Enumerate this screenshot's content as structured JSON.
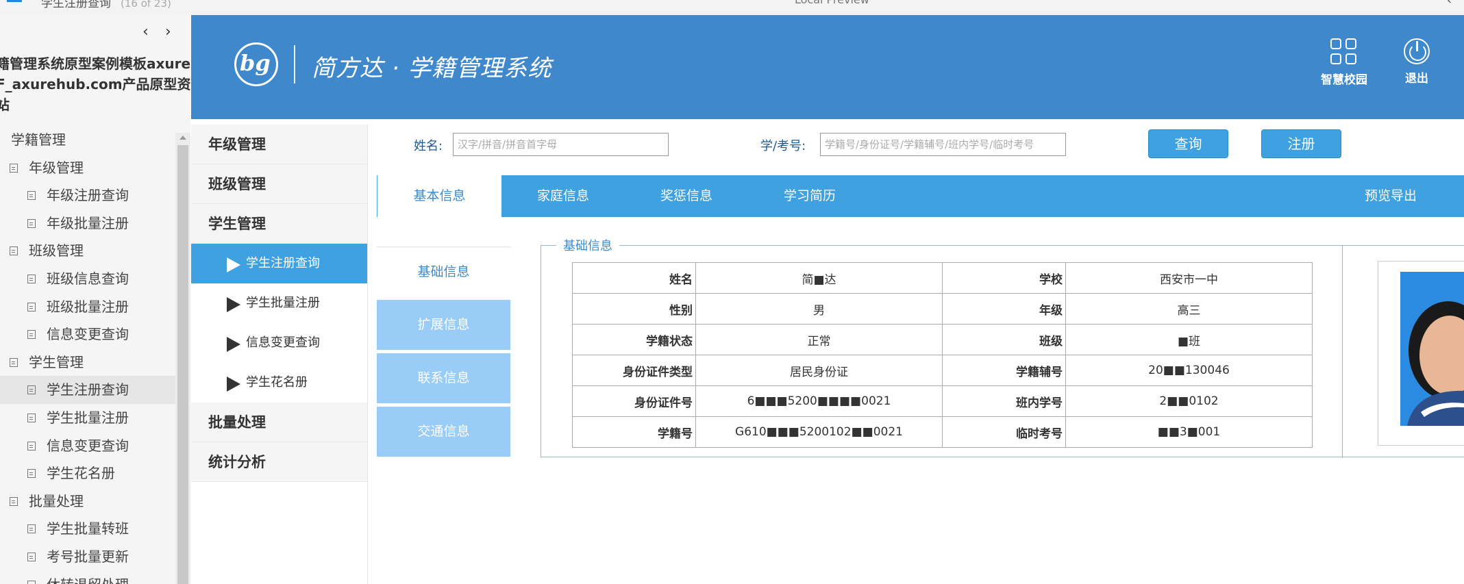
{
  "chrome": {
    "page_title": "学生注册查询",
    "page_count": "(16 of 23)",
    "center_title": "Local Preview"
  },
  "axure_sidebar": {
    "project_title_lines": [
      "籍管理系统原型案例模板axure",
      "F_axurehub.com产品原型资",
      "站"
    ],
    "tree": [
      {
        "label": "学籍管理",
        "level": 0,
        "selected": false
      },
      {
        "label": "年级管理",
        "level": 1,
        "selected": false
      },
      {
        "label": "年级注册查询",
        "level": 2,
        "selected": false
      },
      {
        "label": "年级批量注册",
        "level": 2,
        "selected": false
      },
      {
        "label": "班级管理",
        "level": 1,
        "selected": false
      },
      {
        "label": "班级信息查询",
        "level": 2,
        "selected": false
      },
      {
        "label": "班级批量注册",
        "level": 2,
        "selected": false
      },
      {
        "label": "信息变更查询",
        "level": 2,
        "selected": false
      },
      {
        "label": "学生管理",
        "level": 1,
        "selected": false
      },
      {
        "label": "学生注册查询",
        "level": 2,
        "selected": true
      },
      {
        "label": "学生批量注册",
        "level": 2,
        "selected": false
      },
      {
        "label": "信息变更查询",
        "level": 2,
        "selected": false
      },
      {
        "label": "学生花名册",
        "level": 2,
        "selected": false
      },
      {
        "label": "批量处理",
        "level": 1,
        "selected": false
      },
      {
        "label": "学生批量转班",
        "level": 2,
        "selected": false
      },
      {
        "label": "考号批量更新",
        "level": 2,
        "selected": false
      },
      {
        "label": "休转退留处理",
        "level": 2,
        "selected": false
      }
    ]
  },
  "header": {
    "logo_text": "bg",
    "system_title": "简方达 · 学籍管理系统",
    "actions": [
      {
        "label": "智慧校园",
        "icon": "grid-icon"
      },
      {
        "label": "退出",
        "icon": "power-icon"
      }
    ]
  },
  "side_menu": [
    {
      "label": "年级管理",
      "type": "group"
    },
    {
      "label": "班级管理",
      "type": "group"
    },
    {
      "label": "学生管理",
      "type": "group"
    },
    {
      "label": "学生注册查询",
      "type": "sub",
      "active": true
    },
    {
      "label": "学生批量注册",
      "type": "sub",
      "active": false
    },
    {
      "label": "信息变更查询",
      "type": "sub",
      "active": false
    },
    {
      "label": "学生花名册",
      "type": "sub",
      "active": false
    },
    {
      "label": "批量处理",
      "type": "group"
    },
    {
      "label": "统计分析",
      "type": "group"
    }
  ],
  "search": {
    "name_label": "姓名:",
    "name_placeholder": "汉字/拼音/拼音首字母",
    "id_label": "学/考号:",
    "id_placeholder": "学籍号/身份证号/学籍辅号/班内学号/临时考号",
    "query_button": "查询",
    "register_button": "注册"
  },
  "tabs": {
    "items": [
      "基本信息",
      "家庭信息",
      "奖惩信息",
      "学习简历"
    ],
    "active_index": 0,
    "export_label": "预览导出"
  },
  "sub_tabs": {
    "items": [
      "基础信息",
      "扩展信息",
      "联系信息",
      "交通信息"
    ],
    "active_index": 0
  },
  "info_panel": {
    "legend": "基础信息",
    "rows": [
      {
        "k1": "姓名",
        "v1": "简■达",
        "k2": "学校",
        "v2": "西安市一中"
      },
      {
        "k1": "性别",
        "v1": "男",
        "k2": "年级",
        "v2": "高三"
      },
      {
        "k1": "学籍状态",
        "v1": "正常",
        "k2": "班级",
        "v2": "■班"
      },
      {
        "k1": "身份证件类型",
        "v1": "居民身份证",
        "k2": "学籍辅号",
        "v2": "20■■130046"
      },
      {
        "k1": "身份证件号",
        "v1": "6■■■5200■■■■0021",
        "k2": "班内学号",
        "v2": "2■■0102"
      },
      {
        "k1": "学籍号",
        "v1": "G610■■■5200102■■0021",
        "k2": "临时考号",
        "v2": "■■3■001"
      }
    ]
  },
  "colors": {
    "header_bg": "#3f88cc",
    "accent": "#3fa1df",
    "inactive_subtab": "#99ccf7"
  }
}
